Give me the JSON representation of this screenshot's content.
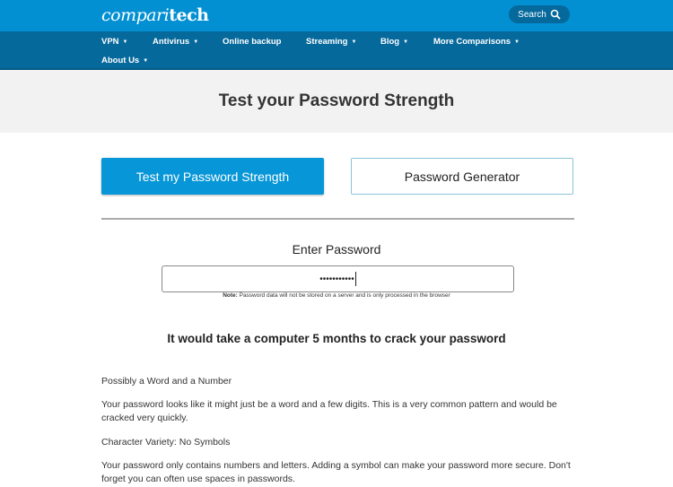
{
  "header": {
    "logo_light": "compari",
    "logo_bold": "tech",
    "search_label": "Search"
  },
  "nav": {
    "items": [
      {
        "label": "VPN",
        "has_dropdown": true
      },
      {
        "label": "Antivirus",
        "has_dropdown": true
      },
      {
        "label": "Online backup",
        "has_dropdown": false
      },
      {
        "label": "Streaming",
        "has_dropdown": true
      },
      {
        "label": "Blog",
        "has_dropdown": true
      },
      {
        "label": "More Comparisons",
        "has_dropdown": true
      },
      {
        "label": "About Us",
        "has_dropdown": true
      }
    ],
    "caret": "▼"
  },
  "hero": {
    "title": "Test your Password Strength"
  },
  "tabs": {
    "test_label": "Test my Password Strength",
    "generator_label": "Password Generator"
  },
  "form": {
    "label": "Enter Password",
    "masked_value": "•••••••••••",
    "note_bold": "Note:",
    "note_text": " Password data will not be stored on a server and is only processed in the browser"
  },
  "result": {
    "headline": "It would take a computer 5 months to crack your password",
    "findings": [
      {
        "title": "Possibly a Word and a Number",
        "body": "Your password looks like it might just be a word and a few digits. This is a very common pattern and would be cracked very quickly."
      },
      {
        "title": "Character Variety: No Symbols",
        "body": "Your password only contains numbers and letters. Adding a symbol can make your password more secure. Don't forget you can often use spaces in passwords."
      }
    ]
  },
  "colors": {
    "brand_blue": "#0290d3",
    "nav_blue": "#06699c",
    "button_blue": "#0796d7"
  }
}
